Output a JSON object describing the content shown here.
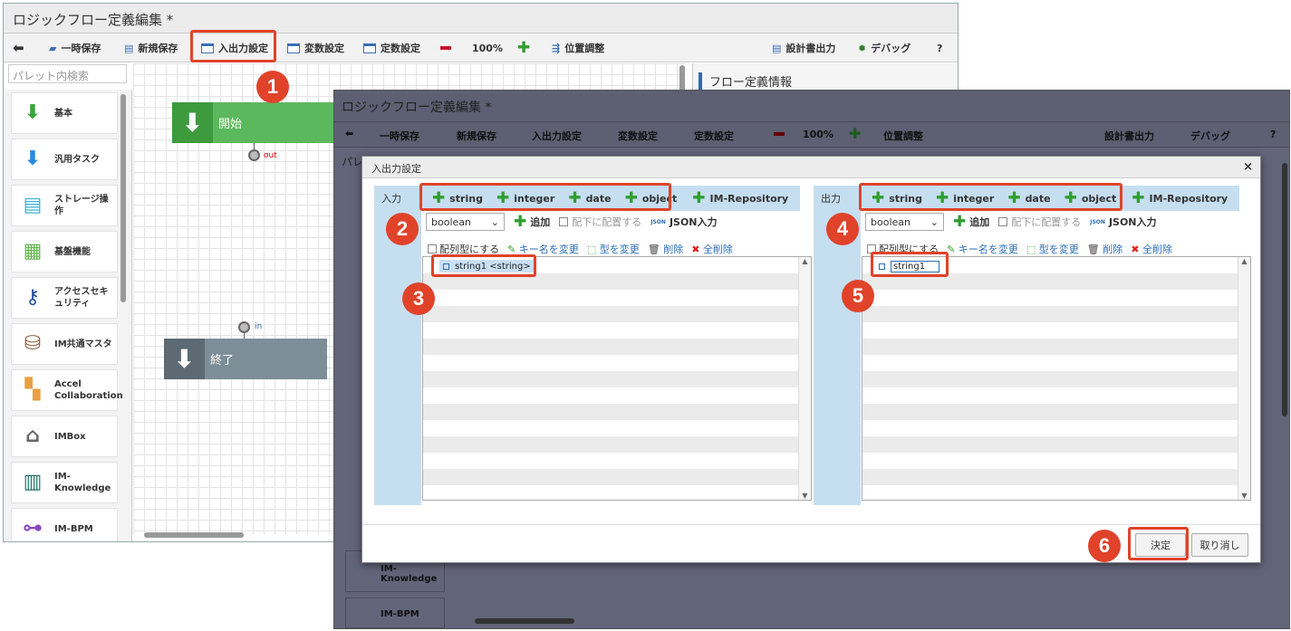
{
  "back_window": {
    "title": "ロジックフロー定義編集 *",
    "toolbar": {
      "save_temp": "一時保存",
      "save_new": "新規保存",
      "io": "入出力設定",
      "vars": "変数設定",
      "consts": "定数設定",
      "zoom": "100%",
      "position": "位置調整",
      "spec": "設計書出力",
      "debug": "デバッグ",
      "help": "?"
    },
    "palette_search_placeholder": "パレット内検索",
    "palette": [
      "基本",
      "汎用タスク",
      "ストレージ操作",
      "基盤機能",
      "アクセスセキュリティ",
      "IM共通マスタ",
      "Accel Collaboration",
      "IMBox",
      "IM-Knowledge",
      "IM-BPM"
    ],
    "nodes": {
      "start": "開始",
      "end": "終了",
      "out_port": "out",
      "in_port": "in"
    },
    "right_panel_title": "フロー定義情報"
  },
  "front_window": {
    "title": "ロジックフロー定義編集 *",
    "toolbar": {
      "save_temp": "一時保存",
      "save_new": "新規保存",
      "io": "入出力設定",
      "vars": "変数設定",
      "consts": "定数設定",
      "zoom": "100%",
      "position": "位置調整",
      "spec": "設計書出力",
      "debug": "デバッグ",
      "help": "?"
    },
    "palette_partial": "パレ",
    "palette_bottom": [
      "IM-Knowledge",
      "IM-BPM"
    ]
  },
  "dialog": {
    "title": "入出力設定",
    "close": "×",
    "types": [
      "string",
      "integer",
      "date",
      "object"
    ],
    "repo": "IM-Repository",
    "input": {
      "label": "入力",
      "select": "boolean",
      "add": "追加",
      "place_under": "配下に配置する",
      "json": "JSON入力",
      "json_icon": "JSON",
      "array": "配列型にする",
      "rename": "キー名を変更",
      "change_type": "型を変更",
      "delete": "削除",
      "delete_all": "全削除",
      "item": "string1 <string>"
    },
    "output": {
      "label": "出力",
      "select": "boolean",
      "add": "追加",
      "place_under": "配下に配置する",
      "json": "JSON入力",
      "json_icon": "JSON",
      "array": "配列型にする",
      "rename": "キー名を変更",
      "change_type": "型を変更",
      "delete": "削除",
      "delete_all": "全削除",
      "item": "string1"
    },
    "ok": "決定",
    "cancel": "取り消し"
  },
  "badges": [
    "1",
    "2",
    "3",
    "4",
    "5",
    "6"
  ]
}
